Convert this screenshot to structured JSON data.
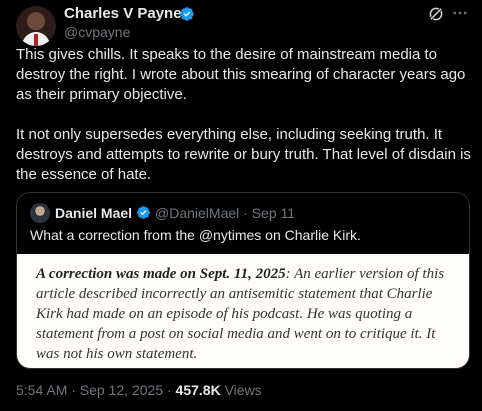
{
  "tweet": {
    "author": {
      "name": "Charles V Payne",
      "handle": "@cvpayne"
    },
    "paragraphs": [
      "This gives chills. It speaks to the desire of mainstream media to destroy the right. I wrote about this smearing of character years ago as their primary objective.",
      "It not only supersedes everything else, including seeking truth. It destroys and attempts to rewrite or bury truth.  That level of disdain is the essence of hate."
    ],
    "timestamp": "5:54 AM · Sep 12, 2025 · ",
    "views_count": "457.8K",
    "views_label": "Views"
  },
  "quote": {
    "name": "Daniel Mael",
    "handle": "@DanielMael",
    "date": "· Sep 11",
    "text": "What a correction from the @nytimes on Charlie Kirk.",
    "image": {
      "lead": "A correction was made on Sept. 11, 2025",
      "body": ": An earlier version of this article described incorrectly an antisemitic statement that Charlie Kirk had made on an episode of his podcast. He was quoting a statement from a post on social media and went on to critique it. It was not his own statement."
    }
  },
  "colors": {
    "background": "#000000",
    "text": "#e7e9ea",
    "muted": "#71767b",
    "verified": "#1d9bf0",
    "border": "#2f3336"
  },
  "icons": {
    "verified": "verified-badge-icon",
    "grok": "grok-icon",
    "more": "more-icon"
  }
}
